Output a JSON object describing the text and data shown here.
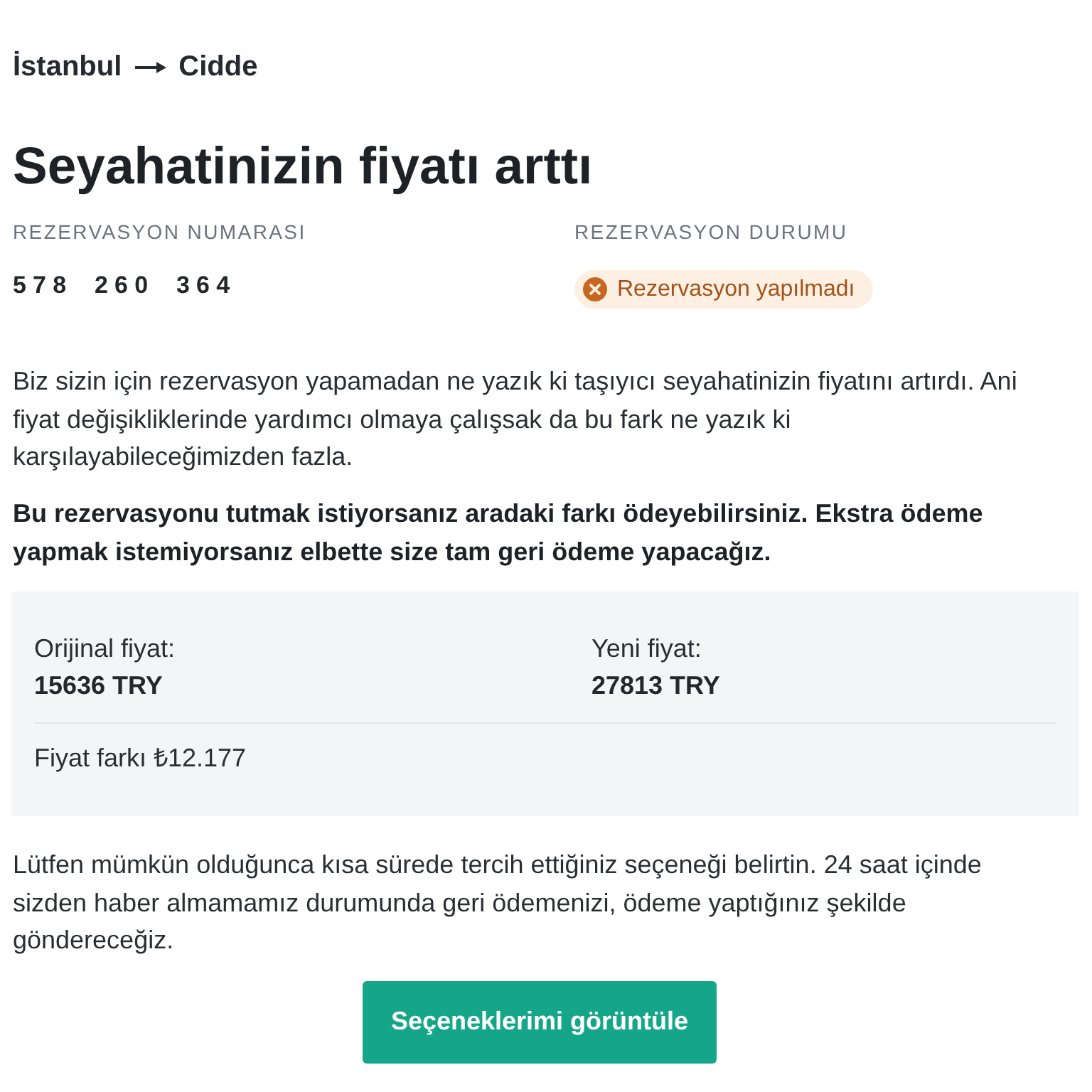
{
  "route": {
    "origin": "İstanbul",
    "destination": "Cidde"
  },
  "title": "Seyahatinizin fiyatı arttı",
  "booking": {
    "number_label": "REZERVASYON NUMARASI",
    "number": "578 260 364",
    "status_label": "REZERVASYON DURUMU",
    "status": {
      "kind": "failed",
      "label": "Rezervasyon yapılmadı"
    }
  },
  "paragraphs": [
    {
      "kind": "normal",
      "text": "Biz sizin için rezervasyon yapamadan ne yazık ki taşıyıcı seyahatinizin fiyatını artırdı. Ani fiyat değişikliklerinde yardımcı olmaya çalışsak da bu fark ne yazık ki karşılayabileceğimizden fazla."
    },
    {
      "kind": "bold",
      "text": "Bu rezervasyonu tutmak istiyorsanız aradaki farkı ödeyebilirsiniz. Ekstra ödeme yapmak istemiyorsanız elbette size tam geri ödeme yapacağız."
    }
  ],
  "prices": {
    "items": [
      {
        "label": "Orijinal fiyat:",
        "value": "15636 TRY"
      },
      {
        "label": "Yeni fiyat:",
        "value": "27813 TRY"
      }
    ],
    "difference": "Fiyat farkı ₺12.177"
  },
  "note": "Lütfen mümkün olduğunca kısa sürede tercih ettiğiniz seçeneği belirtin. 24 saat içinde sizden haber almamamız durumunda geri ödemenizi, ödeme yaptığınız şekilde göndereceğiz.",
  "button": "Seçeneklerimi görüntüle"
}
